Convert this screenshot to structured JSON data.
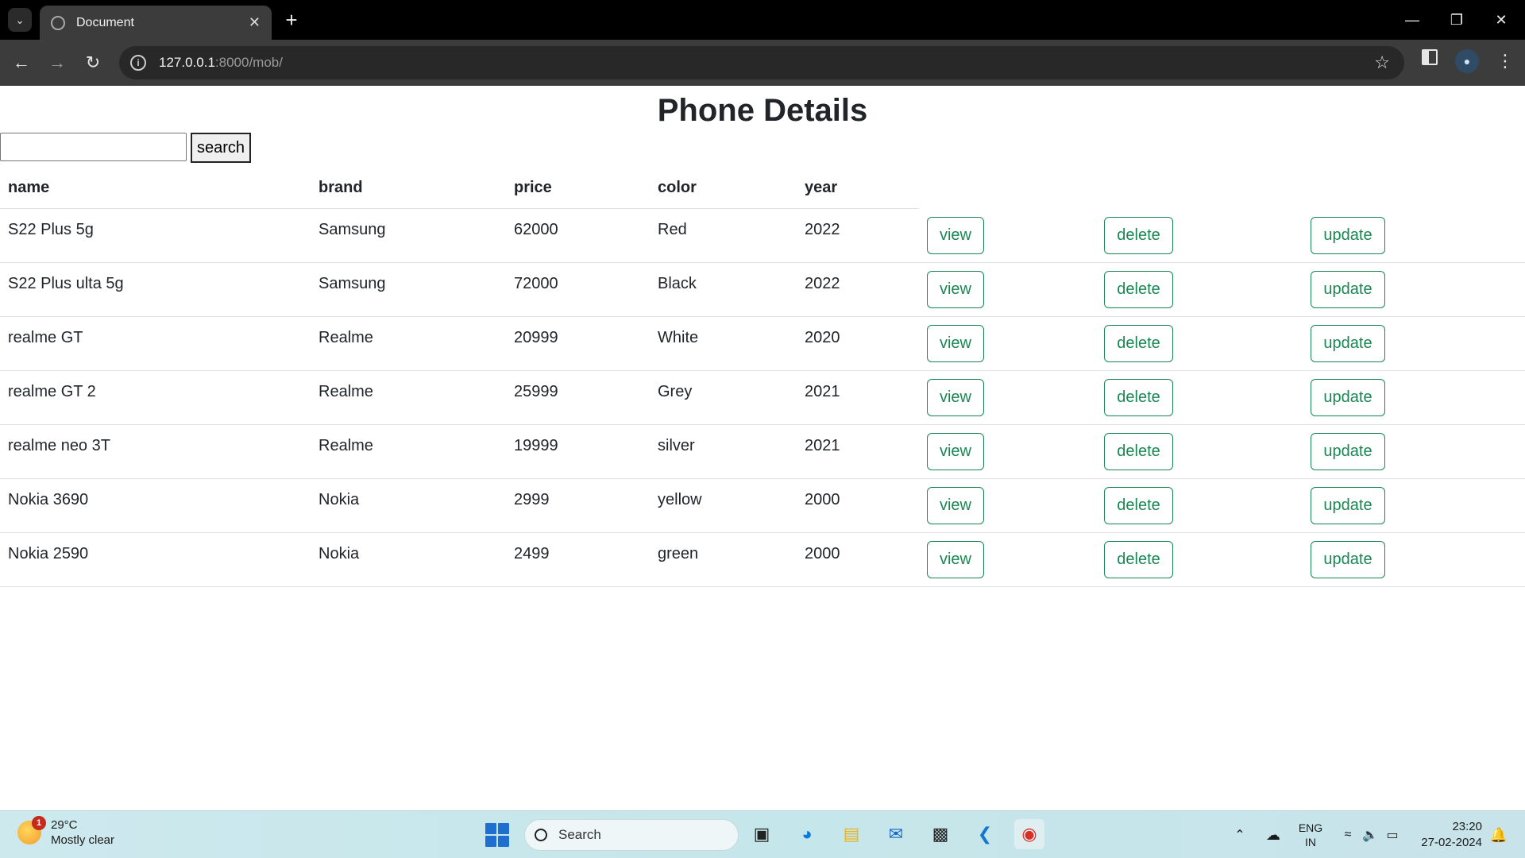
{
  "browser": {
    "tab_title": "Document",
    "url_host": "127.0.0.1",
    "url_path": ":8000/mob/"
  },
  "page": {
    "title": "Phone Details",
    "search_button_label": "search",
    "columns": [
      "name",
      "brand",
      "price",
      "color",
      "year"
    ],
    "action_labels": {
      "view": "view",
      "delete": "delete",
      "update": "update"
    },
    "rows": [
      {
        "name": "S22 Plus 5g",
        "brand": "Samsung",
        "price": "62000",
        "color": "Red",
        "year": "2022"
      },
      {
        "name": "S22 Plus ulta 5g",
        "brand": "Samsung",
        "price": "72000",
        "color": "Black",
        "year": "2022"
      },
      {
        "name": "realme GT",
        "brand": "Realme",
        "price": "20999",
        "color": "White",
        "year": "2020"
      },
      {
        "name": "realme GT 2",
        "brand": "Realme",
        "price": "25999",
        "color": "Grey",
        "year": "2021"
      },
      {
        "name": "realme neo 3T",
        "brand": "Realme",
        "price": "19999",
        "color": "silver",
        "year": "2021"
      },
      {
        "name": "Nokia 3690",
        "brand": "Nokia",
        "price": "2999",
        "color": "yellow",
        "year": "2000"
      },
      {
        "name": "Nokia 2590",
        "brand": "Nokia",
        "price": "2499",
        "color": "green",
        "year": "2000"
      }
    ]
  },
  "taskbar": {
    "weather_badge": "1",
    "weather_temp": "29°C",
    "weather_desc": "Mostly clear",
    "search_label": "Search",
    "lang_line1": "ENG",
    "lang_line2": "IN",
    "time": "23:20",
    "date": "27-02-2024"
  },
  "colors": {
    "accent_green": "#198754",
    "chrome_dark": "#3c3c3c"
  }
}
